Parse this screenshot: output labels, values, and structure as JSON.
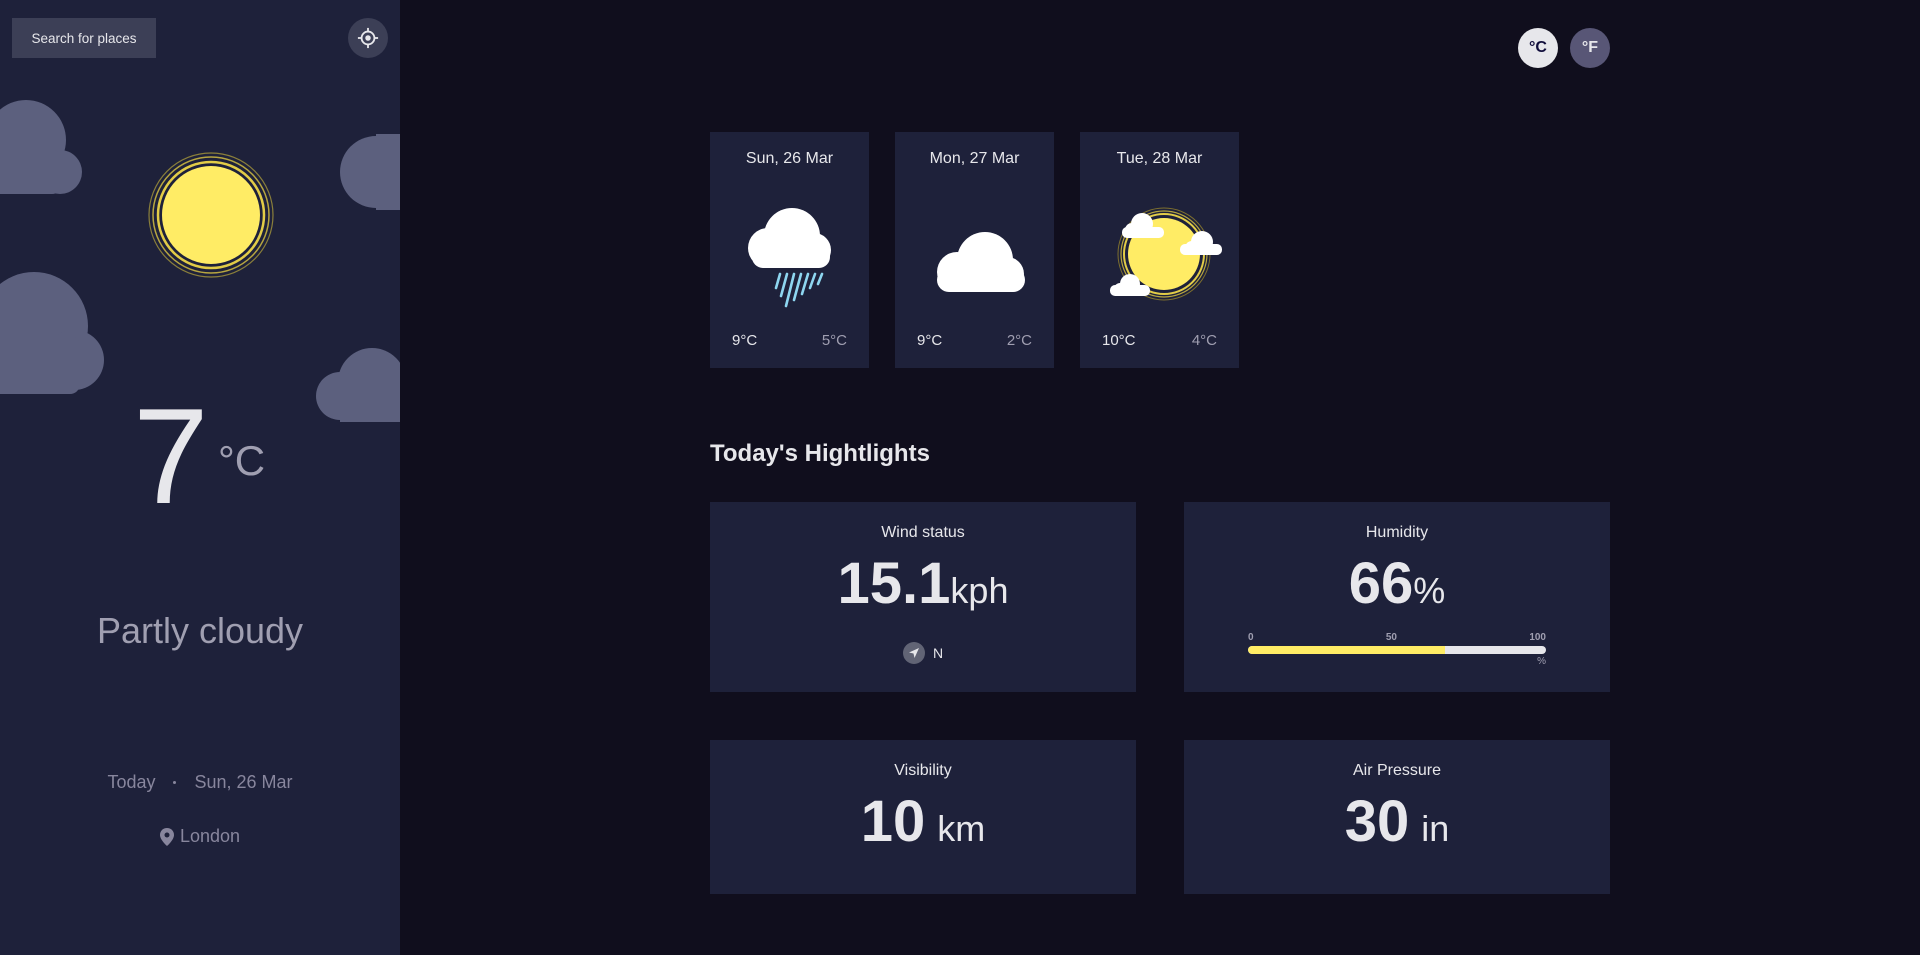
{
  "sidebar": {
    "search_label": "Search for places",
    "current": {
      "temperature": "7",
      "unit": "°C",
      "condition": "Partly cloudy",
      "day_label": "Today",
      "date": "Sun, 26 Mar",
      "location": "London"
    }
  },
  "units": {
    "celsius": "°C",
    "fahrenheit": "°F",
    "selected": "celsius"
  },
  "forecast": [
    {
      "date": "Sun, 26 Mar",
      "max": "9°C",
      "min": "5°C",
      "icon": "rain-cloud-icon"
    },
    {
      "date": "Mon, 27 Mar",
      "max": "9°C",
      "min": "2°C",
      "icon": "cloud-icon"
    },
    {
      "date": "Tue, 28 Mar",
      "max": "10°C",
      "min": "4°C",
      "icon": "sun-cloud-icon"
    }
  ],
  "highlights": {
    "title": "Today's Hightlights",
    "wind": {
      "title": "Wind status",
      "value": "15.1",
      "unit": "kph",
      "direction": "N"
    },
    "humidity": {
      "title": "Humidity",
      "value": "66",
      "unit": "%",
      "scale": [
        "0",
        "50",
        "100"
      ],
      "scale_unit": "%",
      "percent": 66
    },
    "visibility": {
      "title": "Visibility",
      "value": "10",
      "unit": "km"
    },
    "pressure": {
      "title": "Air Pressure",
      "value": "30",
      "unit": "in"
    }
  },
  "colors": {
    "sidebar_bg": "#1E213A",
    "page_bg": "#100E1D",
    "accent_yellow": "#FFEC65"
  }
}
